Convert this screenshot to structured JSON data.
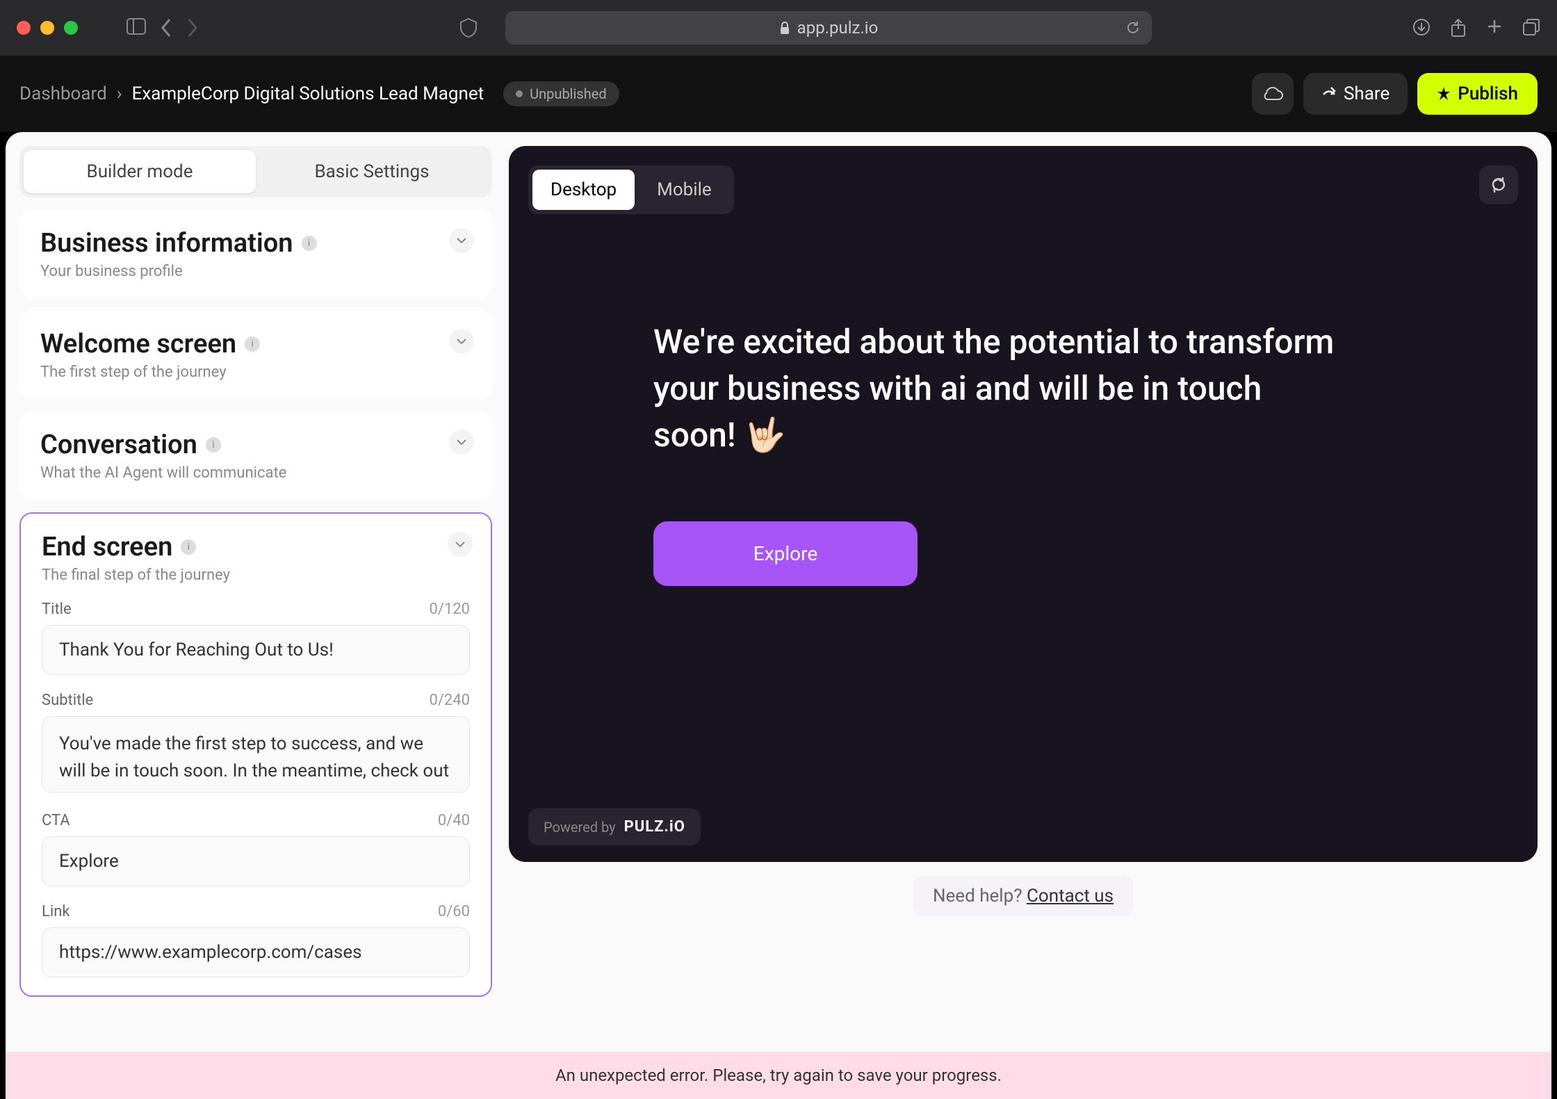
{
  "browser": {
    "url": "app.pulz.io"
  },
  "breadcrumb": {
    "dashboard": "Dashboard",
    "current": "ExampleCorp Digital Solutions Lead Magnet"
  },
  "status": {
    "label": "Unpublished"
  },
  "header": {
    "share": "Share",
    "publish": "Publish"
  },
  "modes": {
    "builder": "Builder mode",
    "settings": "Basic Settings"
  },
  "cards": {
    "business": {
      "title": "Business information",
      "subtitle": "Your business profile"
    },
    "welcome": {
      "title": "Welcome screen",
      "subtitle": "The first step of the journey"
    },
    "conversation": {
      "title": "Conversation",
      "subtitle": "What the AI Agent will communicate"
    },
    "end": {
      "title": "End screen",
      "subtitle": "The final step of the journey"
    }
  },
  "form": {
    "title_label": "Title",
    "title_counter": "0/120",
    "title_value": "Thank You for Reaching Out to Us!",
    "subtitle_label": "Subtitle",
    "subtitle_counter": "0/240",
    "subtitle_value": "You've made the first step to success, and we will be in touch soon. In the meantime, check out our top",
    "cta_label": "CTA",
    "cta_counter": "0/40",
    "cta_value": "Explore",
    "link_label": "Link",
    "link_counter": "0/60",
    "link_value": "https://www.examplecorp.com/cases"
  },
  "preview": {
    "device_desktop": "Desktop",
    "device_mobile": "Mobile",
    "title": "We're excited about the potential to transform your business with ai and will be in touch soon! 🤟🏻",
    "cta": "Explore",
    "powered_by": "Powered by",
    "logo": "PULZ.iO"
  },
  "help": {
    "text": "Need help? ",
    "link": "Contact us"
  },
  "error": {
    "message": "An unexpected error. Please, try again to save your progress."
  }
}
